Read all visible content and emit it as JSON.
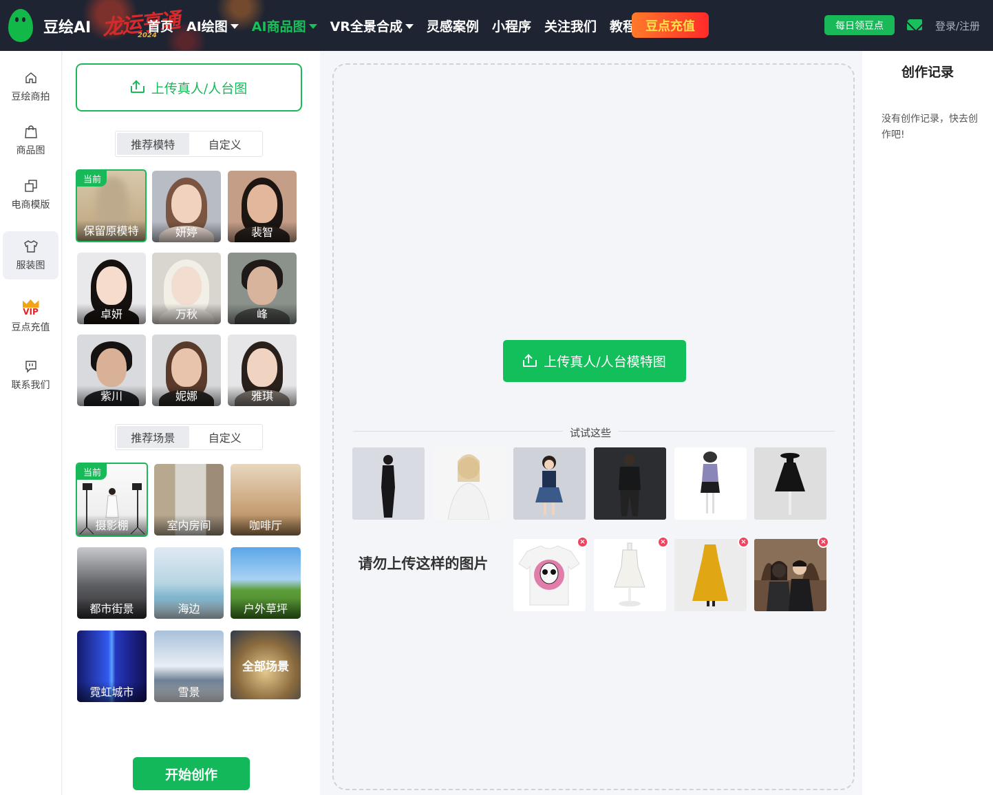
{
  "header": {
    "brand": "豆绘AI",
    "festive_text": "龙运亨通",
    "festive_year": "2024",
    "nav": [
      {
        "label": "首页",
        "dropdown": false,
        "active": false
      },
      {
        "label": "AI绘图",
        "dropdown": true,
        "active": false
      },
      {
        "label": "AI商品图",
        "dropdown": true,
        "active": true
      },
      {
        "label": "VR全景合成",
        "dropdown": true,
        "active": false
      },
      {
        "label": "灵感案例",
        "dropdown": false,
        "active": false
      },
      {
        "label": "小程序",
        "dropdown": false,
        "active": false
      },
      {
        "label": "关注我们",
        "dropdown": false,
        "active": false
      },
      {
        "label": "教程",
        "dropdown": false,
        "active": false
      }
    ],
    "recharge_label": "豆点充值",
    "daily_label": "每日领豆点",
    "login_label": "登录/注册"
  },
  "sidebar": {
    "items": [
      {
        "label": "豆绘商拍",
        "icon": "home-icon",
        "active": false
      },
      {
        "label": "商品图",
        "icon": "shopping-bag-icon",
        "active": false
      },
      {
        "label": "电商模版",
        "icon": "copy-icon",
        "active": false
      },
      {
        "label": "服装图",
        "icon": "tshirt-icon",
        "active": true
      },
      {
        "label": "豆点充值",
        "icon": "vip-crown-icon",
        "active": false,
        "vip_text": "VIP"
      },
      {
        "label": "联系我们",
        "icon": "chat-icon",
        "active": false
      }
    ]
  },
  "panel": {
    "upload_label": "上传真人/人台图",
    "model_tabs": [
      "推荐模特",
      "自定义"
    ],
    "current_badge": "当前",
    "models": [
      {
        "name": "保留原模特",
        "selected": true
      },
      {
        "name": "妍婷",
        "selected": false
      },
      {
        "name": "裴智",
        "selected": false
      },
      {
        "name": "卓妍",
        "selected": false
      },
      {
        "name": "万秋",
        "selected": false
      },
      {
        "name": "峰",
        "selected": false
      },
      {
        "name": "紫川",
        "selected": false
      },
      {
        "name": "妮娜",
        "selected": false
      },
      {
        "name": "雅琪",
        "selected": false
      }
    ],
    "scene_tabs": [
      "推荐场景",
      "自定义"
    ],
    "scenes": [
      {
        "name": "摄影棚",
        "selected": true
      },
      {
        "name": "室内房间",
        "selected": false
      },
      {
        "name": "咖啡厅",
        "selected": false
      },
      {
        "name": "都市街景",
        "selected": false
      },
      {
        "name": "海边",
        "selected": false
      },
      {
        "name": "户外草坪",
        "selected": false
      },
      {
        "name": "霓虹城市",
        "selected": false
      },
      {
        "name": "雪景",
        "selected": false
      },
      {
        "name": "全部场景",
        "selected": false
      }
    ],
    "start_label": "开始创作"
  },
  "workspace": {
    "upload_label": "上传真人/人台模特图",
    "try_label": "试试这些",
    "warning_text": "请勿上传这样的图片",
    "remove_mark": "×"
  },
  "history": {
    "title": "创作记录",
    "empty_text": "没有创作记录，快去创作吧!"
  },
  "colors": {
    "accent": "#19b95a",
    "topbar": "#1e2432",
    "recharge_gradient_start": "#ff7a2b",
    "recharge_gradient_end": "#ff2a2a",
    "warning_red": "#f0445e"
  }
}
